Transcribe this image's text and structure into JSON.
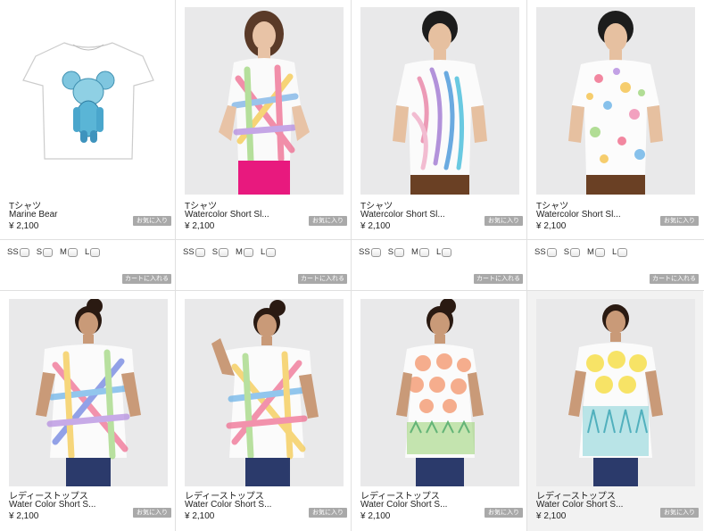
{
  "products_row1": [
    {
      "category": "Tシャツ",
      "name": "Marine Bear",
      "price": "¥ 2,100",
      "fav_label": "お気に入り",
      "image": "marine-bear-tshirt"
    },
    {
      "category": "Tシャツ",
      "name": "Watercolor Short Sl...",
      "price": "¥ 2,100",
      "fav_label": "お気に入り",
      "image": "woman-plaid-watercolor-tee"
    },
    {
      "category": "Tシャツ",
      "name": "Watercolor Short Sl...",
      "price": "¥ 2,100",
      "fav_label": "お気に入り",
      "image": "man-zebra-watercolor-tee"
    },
    {
      "category": "Tシャツ",
      "name": "Watercolor Short Sl...",
      "price": "¥ 2,100",
      "fav_label": "お気に入り",
      "image": "man-dots-watercolor-tee"
    }
  ],
  "size_options": [
    "SS",
    "S",
    "M",
    "L"
  ],
  "cart_label": "カートに入れる",
  "products_row2": [
    {
      "category": "レディーストップス",
      "name": "Water Color Short S...",
      "price": "¥ 2,100",
      "fav_label": "お気に入り",
      "image": "woman-plaid-tunic"
    },
    {
      "category": "レディーストップス",
      "name": "Water Color Short S...",
      "price": "¥ 2,100",
      "fav_label": "お気に入り",
      "image": "woman-plaid-tunic-yellow"
    },
    {
      "category": "レディーストップス",
      "name": "Water Color Short S...",
      "price": "¥ 2,100",
      "fav_label": "お気に入り",
      "image": "woman-orange-dots-tunic"
    },
    {
      "category": "レディーストップス",
      "name": "Water Color Short S...",
      "price": "¥ 2,100",
      "fav_label": "お気に入り",
      "image": "woman-yellow-flower-tunic"
    }
  ]
}
